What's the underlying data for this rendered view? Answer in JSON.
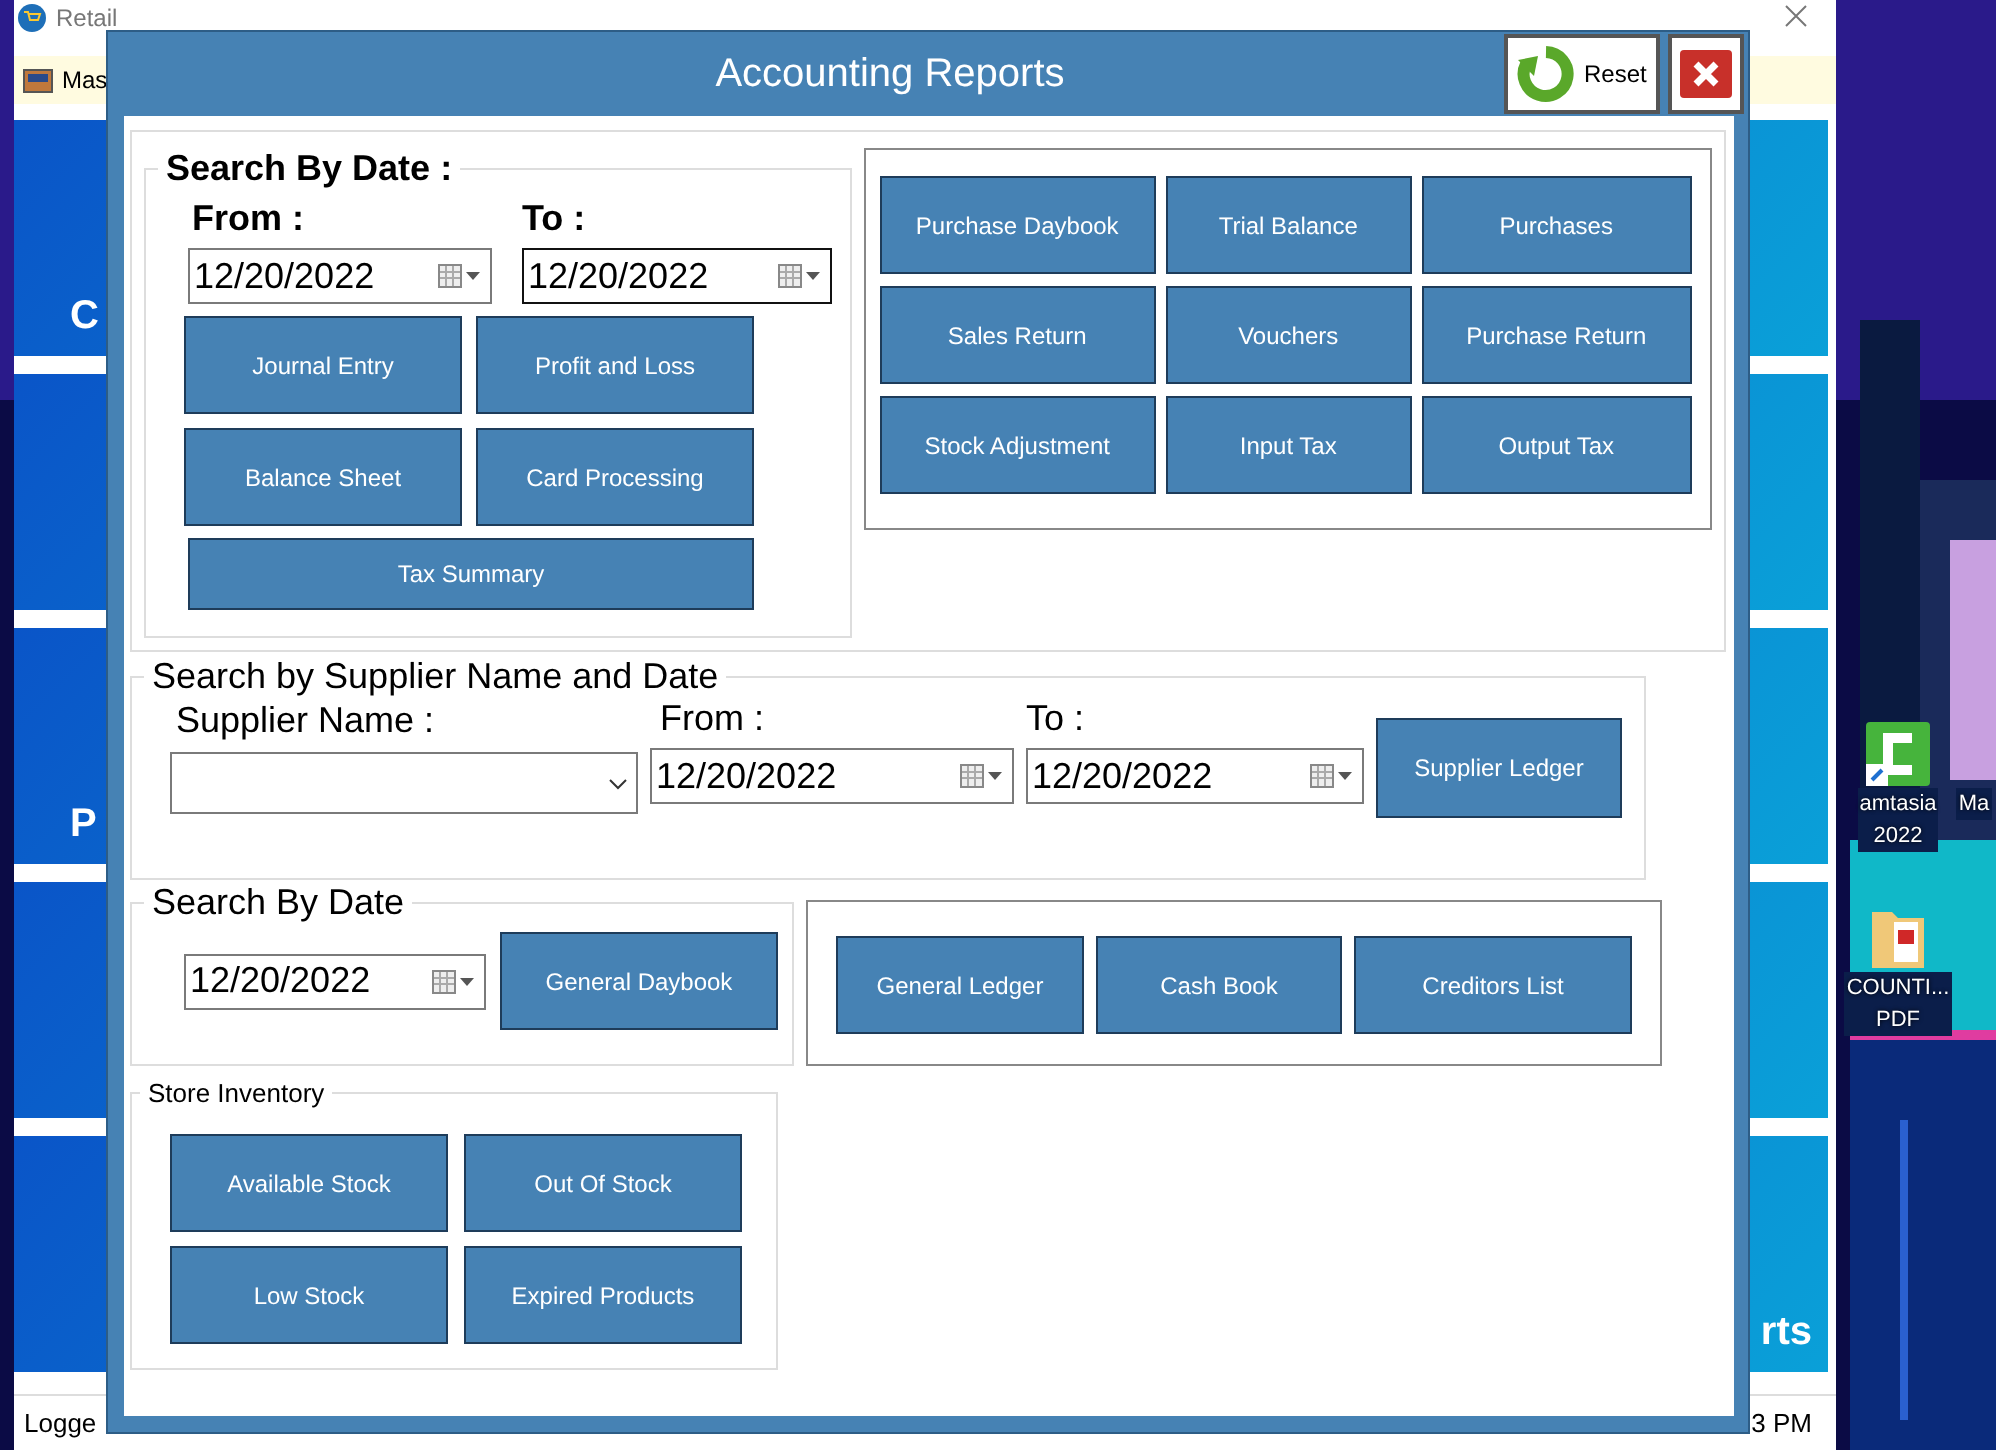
{
  "desktop": {
    "icons": [
      {
        "kind": "app",
        "lines": [
          "amtasia",
          "2022"
        ]
      },
      {
        "kind": "cut",
        "lines": [
          "Ma"
        ]
      },
      {
        "kind": "pdf",
        "lines": [
          "COUNTI...",
          "PDF"
        ]
      }
    ]
  },
  "app_window": {
    "title": "Retail",
    "menu": [
      {
        "label": "Mas"
      }
    ],
    "tiles": [
      {
        "kind": "caption_start",
        "caption": "C"
      },
      {
        "kind": "plain"
      },
      {
        "kind": "caption_start",
        "caption": "P"
      },
      {
        "kind": "plain"
      },
      {
        "kind": "caption_end",
        "caption": "rts"
      }
    ],
    "status_bar": {
      "left": "Logge",
      "right": "3 PM"
    }
  },
  "dialog": {
    "title": "Accounting Reports",
    "reset_button": "Reset",
    "date_search": {
      "title": "Search By Date :",
      "from_label": "From :",
      "to_label": "To :",
      "from_date": {
        "value": "12/20/2022",
        "focused": false
      },
      "to_date": {
        "value": "12/20/2022",
        "focused": true
      },
      "buttons": [
        "Journal Entry",
        "Profit and Loss",
        "Balance Sheet",
        "Card Processing",
        "Tax Summary"
      ]
    },
    "report_buttons": [
      "Purchase Daybook",
      "Trial Balance",
      "Purchases",
      "Sales Return",
      "Vouchers",
      "Purchase Return",
      "Stock Adjustment",
      "Input Tax",
      "Output Tax"
    ],
    "supplier_search": {
      "title": "Search by Supplier Name and Date",
      "supplier_label": "Supplier Name :",
      "from_label": "From :",
      "to_label": "To :",
      "from_date": {
        "value": "12/20/2022",
        "focused": false
      },
      "to_date": {
        "value": "12/20/2022",
        "focused": false
      },
      "button": "Supplier Ledger"
    },
    "daybook_search": {
      "title": "Search By Date",
      "date": {
        "value": "12/20/2022",
        "focused": false
      },
      "button": "General Daybook"
    },
    "ledger_buttons": [
      "General Ledger",
      "Cash Book",
      "Creditors List"
    ],
    "store_inventory": {
      "title": "Store Inventory",
      "buttons": [
        "Available Stock",
        "Out Of Stock",
        "Low Stock",
        "Expired Products"
      ]
    }
  }
}
